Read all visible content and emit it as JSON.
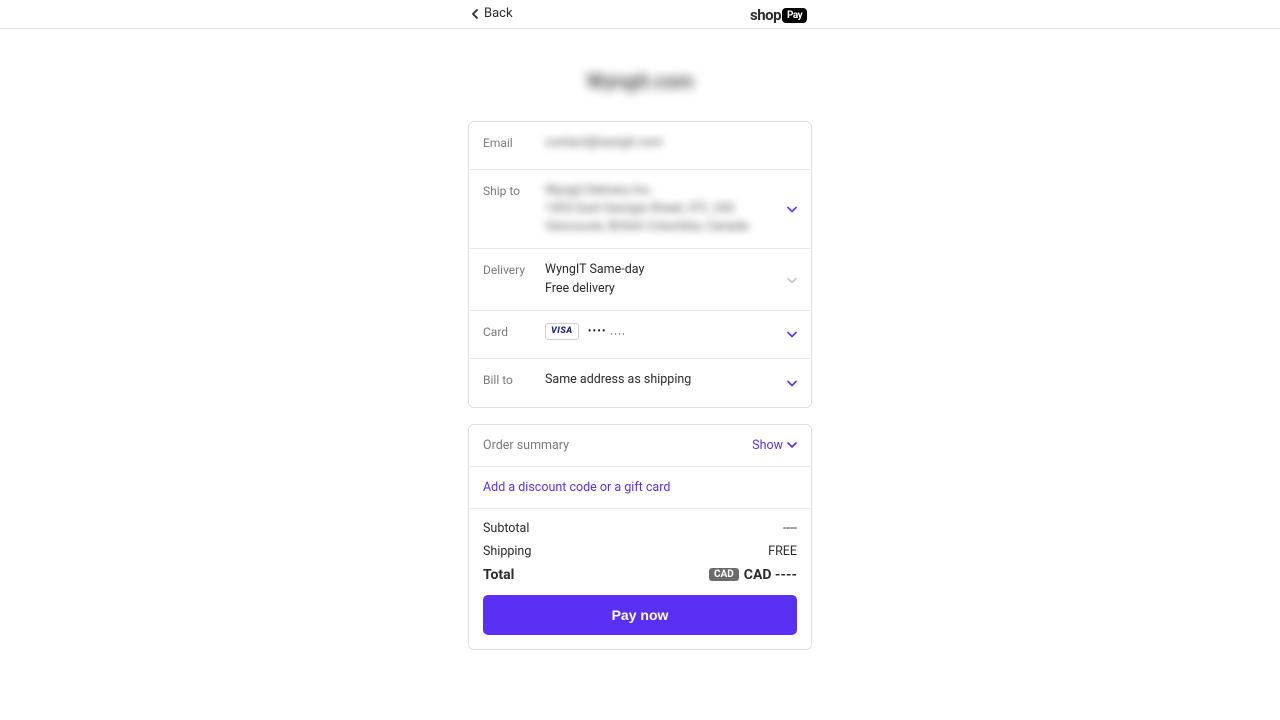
{
  "header": {
    "back_label": "Back",
    "brand_text": "shop",
    "brand_badge": "Pay"
  },
  "store_name": "Wyngit.com",
  "review": {
    "email": {
      "label": "Email",
      "value": "contact@wyngit.com"
    },
    "ship_to": {
      "label": "Ship to",
      "line1": "Wyngit Delivery Inc.",
      "line2": "1453 East Georgia Street, STL 243",
      "line3": "Vancouver, British Columbia, Canada"
    },
    "delivery": {
      "label": "Delivery",
      "method": "WyngIT Same-day",
      "price_text": "Free delivery"
    },
    "card": {
      "label": "Card",
      "brand": "VISA",
      "masked": "•••• ...."
    },
    "bill_to": {
      "label": "Bill to",
      "value": "Same address as shipping"
    }
  },
  "summary": {
    "title": "Order summary",
    "toggle_label": "Show",
    "discount_link": "Add a discount code or a gift card",
    "subtotal_label": "Subtotal",
    "subtotal_value": "----",
    "shipping_label": "Shipping",
    "shipping_value": "FREE",
    "total_label": "Total",
    "currency_badge": "CAD",
    "total_value": "CAD ----",
    "pay_button": "Pay now"
  }
}
